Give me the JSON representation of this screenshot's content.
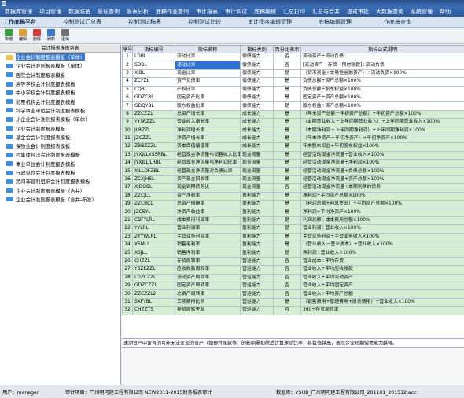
{
  "window": {
    "title": ""
  },
  "menu": [
    "数据库管理",
    "项目管理",
    "数据准备",
    "账证查询",
    "账表分析",
    "底稿作业查询",
    "审计报表",
    "审计调试",
    "底稿编辑",
    "汇总打印",
    "汇总与合并",
    "提成审批",
    "大数据查询",
    "系统管理",
    "帮助"
  ],
  "tabs": [
    "工作底稿平台",
    "控制测试汇总表",
    "控制测试稿表",
    "控制测试比较",
    "审计程序编辑管理",
    "底稿编辑管理",
    "工作底稿查询"
  ],
  "toolbar": [
    {
      "label": "新增",
      "icon": "add-icon",
      "color": "#3a9b3a"
    },
    {
      "label": "编辑",
      "icon": "edit-icon",
      "color": "#d9a13b"
    },
    {
      "label": "删除",
      "icon": "delete-icon",
      "color": "#d04040"
    },
    {
      "label": "刷新",
      "icon": "refresh-icon",
      "color": "#3a78c8"
    },
    {
      "label": "退出",
      "icon": "exit-icon",
      "color": "#707070"
    }
  ],
  "sidebar": {
    "header": "会计报表模板列表",
    "items": [
      {
        "label": "企业会计制度报表模板（单体）",
        "selected": true
      },
      {
        "label": "企业会计准则报表模板（单体）",
        "selected": false
      },
      {
        "label": "医院会计制度报表模板",
        "selected": false
      },
      {
        "label": "高等学校会计制度报表模板",
        "selected": false
      },
      {
        "label": "中小学校会计制度报表模板",
        "selected": false
      },
      {
        "label": "彩票机构会计制度报表模板",
        "selected": false
      },
      {
        "label": "科学事业单位会计制度报表模板",
        "selected": false
      },
      {
        "label": "小企业会计准则报表模板（单体）",
        "selected": false
      },
      {
        "label": "企业会计制度报表模板",
        "selected": false
      },
      {
        "label": "基金会会计制度报表模板",
        "selected": false
      },
      {
        "label": "保险业会计制度报表模板",
        "selected": false
      },
      {
        "label": "村集体经济会计制度报表模板",
        "selected": false
      },
      {
        "label": "事业单位会计制度报表模板",
        "selected": false
      },
      {
        "label": "行政单位会计制度报表模板",
        "selected": false
      },
      {
        "label": "民间非营利组织会计制度报表模板",
        "selected": false
      },
      {
        "label": "企业会计制度报表模板（合并）",
        "selected": false
      },
      {
        "label": "企业会计准则报表模板（合并-新准）",
        "selected": false
      }
    ]
  },
  "grid": {
    "columns": [
      "序号",
      "指标编号",
      "指标名称",
      "指标类别",
      "百分比表示",
      "指标公式说明"
    ],
    "rows": [
      {
        "n": "1",
        "code": "LDBL",
        "name": "流动比率",
        "cat": "偿债能力",
        "pct": "否",
        "formula": "流动资产÷流动负债",
        "style": "white"
      },
      {
        "n": "2",
        "code": "SDBL",
        "name": "速动比率",
        "cat": "偿债能力",
        "pct": "否",
        "formula": "[流动资产－存货－预付账款]÷流动负债",
        "style": "sel"
      },
      {
        "n": "3",
        "code": "XJBL",
        "name": "现金比率",
        "cat": "偿债能力",
        "pct": "是",
        "formula": "（货币资金+交易性金融资产）÷流动负债×100%",
        "style": "white"
      },
      {
        "n": "4",
        "code": "ZCFZL",
        "name": "资产负债率",
        "cat": "偿债能力",
        "pct": "是",
        "formula": "负债总额÷资产总额×100%",
        "style": "white"
      },
      {
        "n": "5",
        "code": "CQBL",
        "name": "产权比率",
        "cat": "偿债能力",
        "pct": "是",
        "formula": "负债总额÷股东权益×100%",
        "style": "white"
      },
      {
        "n": "6",
        "code": "GDZCBL",
        "name": "固定资产比率",
        "cat": "偿债能力",
        "pct": "是",
        "formula": "固定资产÷资产总额×100%",
        "style": "white"
      },
      {
        "n": "7",
        "code": "GDQYBL",
        "name": "股东权益比率",
        "cat": "偿债能力",
        "pct": "是",
        "formula": "股东权益÷资产总额×100%",
        "style": "white"
      },
      {
        "n": "8",
        "code": "ZZCZZL",
        "name": "总资产增长率",
        "cat": "成长能力",
        "pct": "是",
        "formula": "（年末资产总额－年初资产总额）÷年初资产总额×100%",
        "style": "green"
      },
      {
        "n": "9",
        "code": "YYSRZZL",
        "name": "营业收入增长率",
        "cat": "成长能力",
        "pct": "是",
        "formula": "（本期营业收入－上年同期营业收入）÷上年同期营业收入×100%",
        "style": "green"
      },
      {
        "n": "10",
        "code": "JLRZZL",
        "name": "净利润增长率",
        "cat": "成长能力",
        "pct": "是",
        "formula": "（本期净利润－上年同期净利润）÷上年同期净利润×100%",
        "style": "green"
      },
      {
        "n": "11",
        "code": "JZCZZL",
        "name": "净资产增长率",
        "cat": "成长能力",
        "pct": "是",
        "formula": "（年末净资产－年初净资产）÷年初净资产×100%",
        "style": "green"
      },
      {
        "n": "12",
        "code": "ZBBZZZL",
        "name": "资本保值增值率",
        "cat": "成长能力",
        "pct": "是",
        "formula": "年末股东权益÷年初股东权益×100%",
        "style": "green"
      },
      {
        "n": "13",
        "code": "JYXJLLXSSRBL",
        "name": "经营现金净流量与销售收入比率",
        "cat": "现金流量",
        "pct": "是",
        "formula": "经营活动现金净流量÷营业收入×100%",
        "style": "green"
      },
      {
        "n": "14",
        "code": "JYXJLLJLRBL",
        "name": "经营现金净流量与净利润比率",
        "cat": "现金流量",
        "pct": "是",
        "formula": "经营活动现金净流量÷净利润×100%",
        "style": "green"
      },
      {
        "n": "15",
        "code": "XJLLDFZBL",
        "name": "经营现金净流量对负债比率",
        "cat": "现金流量",
        "pct": "是",
        "formula": "经营活动现金净流量÷负债总额×100%",
        "style": "green"
      },
      {
        "n": "16",
        "code": "ZCXJHSL",
        "name": "资产现金回收率",
        "cat": "现金流量",
        "pct": "是",
        "formula": "经营活动现金净流量÷资产总额×100%",
        "style": "green"
      },
      {
        "n": "17",
        "code": "XJDQBL",
        "name": "现金到期债务比",
        "cat": "现金流量",
        "pct": "否",
        "formula": "经营活动现金净流量÷本期到期的债务",
        "style": "green"
      },
      {
        "n": "18",
        "code": "ZZCJLL",
        "name": "资产净利率",
        "cat": "盈利能力",
        "pct": "是",
        "formula": "净利润÷平均资产总额×100%",
        "style": "green"
      },
      {
        "n": "19",
        "code": "ZZCBCL",
        "name": "总资产报酬率",
        "cat": "盈利能力",
        "pct": "是",
        "formula": "（利润总额+利息支出）÷平均资产总额×100%",
        "style": "green"
      },
      {
        "n": "20",
        "code": "JZCSYL",
        "name": "净资产收益率",
        "cat": "盈利能力",
        "pct": "是",
        "formula": "净利润÷平均净资产×100%",
        "style": "green"
      },
      {
        "n": "21",
        "code": "CBFYLRL",
        "name": "成本费用利润率",
        "cat": "盈利能力",
        "pct": "是",
        "formula": "利润总额÷成本费用总额×100%",
        "style": "green"
      },
      {
        "n": "22",
        "code": "YYLRL",
        "name": "营业利润率",
        "cat": "盈利能力",
        "pct": "是",
        "formula": "营业利润÷营业收入×100%",
        "style": "green"
      },
      {
        "n": "23",
        "code": "ZYYWLRL",
        "name": "主营业务利润率",
        "cat": "盈利能力",
        "pct": "是",
        "formula": "主营业务利润÷主营业务收入×100%",
        "style": "green"
      },
      {
        "n": "24",
        "code": "XSMLL",
        "name": "销售毛利率",
        "cat": "盈利能力",
        "pct": "是",
        "formula": "（营业收入－营业成本）÷营业收入×100%",
        "style": "green"
      },
      {
        "n": "25",
        "code": "XSJLL",
        "name": "销售净利率",
        "cat": "盈利能力",
        "pct": "是",
        "formula": "净利润÷营业收入×100%",
        "style": "green"
      },
      {
        "n": "26",
        "code": "CHZZL",
        "name": "存货周转率",
        "cat": "营运能力",
        "pct": "否",
        "formula": "营业成本÷平均存货",
        "style": "green"
      },
      {
        "n": "27",
        "code": "YSZKZZL",
        "name": "应收账款周转率",
        "cat": "营运能力",
        "pct": "否",
        "formula": "营业收入÷平均应收账款",
        "style": "green"
      },
      {
        "n": "28",
        "code": "LDZCZZL",
        "name": "流动资产周转率",
        "cat": "营运能力",
        "pct": "否",
        "formula": "营业收入÷平均流动资产",
        "style": "green"
      },
      {
        "n": "29",
        "code": "GDZCZZL",
        "name": "固定资产周转率",
        "cat": "营运能力",
        "pct": "否",
        "formula": "营业收入÷平均固定资产",
        "style": "green"
      },
      {
        "n": "30",
        "code": "ZZCZZL2",
        "name": "总资产周转率",
        "cat": "营运能力",
        "pct": "否",
        "formula": "营业收入÷平均资产总额",
        "style": "green"
      },
      {
        "n": "31",
        "code": "SXFYBL",
        "name": "三项费用比例",
        "cat": "营运能力",
        "pct": "是",
        "formula": "（销售费用+管理费用+财务费用）÷营业收入×100%",
        "style": "green"
      },
      {
        "n": "32",
        "code": "CHZZTS",
        "name": "存货周转天数",
        "cat": "营运能力",
        "pct": "否",
        "formula": "360÷存货周转率",
        "style": "green"
      }
    ]
  },
  "detail": "速动资产中含有的可能无法变现的资产（如预付账款等）的影响需扣除后计算速动比率；其数值越高，表示企业短期偿债能力越强。",
  "status": {
    "user": "用户：manager",
    "project": "审计项目：广州明河建工程有限公司 NEW2011-2015财务报表审计",
    "db": "数据库：YSHB_广州明河建工程有限公司_201101_201512.acc"
  }
}
